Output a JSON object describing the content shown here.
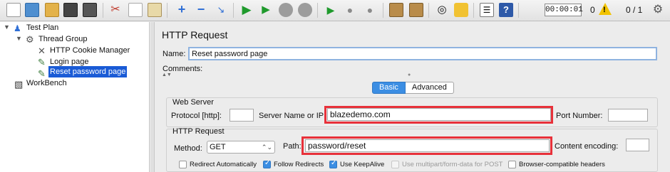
{
  "toolbar": {
    "icons": [
      "new-icon",
      "templates-icon",
      "open-icon",
      "save-icon",
      "save-as-icon",
      "cut-icon",
      "copy-icon",
      "paste-icon",
      "expand-icon",
      "collapse-icon",
      "toggle-icon",
      "start-icon",
      "start-no-pause-icon",
      "stop-icon",
      "shutdown-icon",
      "remote-start-icon",
      "remote-stop-icon",
      "remote-shutdown-icon",
      "clear-icon",
      "clear-all-icon",
      "search-icon",
      "reset-search-icon",
      "function-helper-icon",
      "help-icon"
    ],
    "timer": "00:00:01",
    "warning_count": "0",
    "threads": "0 / 1"
  },
  "tree": {
    "items": [
      {
        "label": "Test Plan"
      },
      {
        "label": "Thread Group"
      },
      {
        "label": "HTTP Cookie Manager"
      },
      {
        "label": "Login page"
      },
      {
        "label": "Reset password page"
      },
      {
        "label": "WorkBench"
      }
    ]
  },
  "panel": {
    "title": "HTTP Request",
    "name_label": "Name:",
    "name_value": "Reset password page",
    "comments_label": "Comments:",
    "tabs": [
      "Basic",
      "Advanced"
    ],
    "web_server": {
      "legend": "Web Server",
      "protocol_label": "Protocol [http]:",
      "protocol_value": "",
      "server_label": "Server Name or IP:",
      "server_value": "blazedemo.com",
      "port_label": "Port Number:",
      "port_value": ""
    },
    "http_request": {
      "legend": "HTTP Request",
      "method_label": "Method:",
      "method_value": "GET",
      "path_label": "Path:",
      "path_value": "password/reset",
      "encoding_label": "Content encoding:",
      "encoding_value": ""
    },
    "options": [
      {
        "label": "Redirect Automatically",
        "checked": false,
        "enabled": true
      },
      {
        "label": "Follow Redirects",
        "checked": true,
        "enabled": true
      },
      {
        "label": "Use KeepAlive",
        "checked": true,
        "enabled": true
      },
      {
        "label": "Use multipart/form-data for POST",
        "checked": false,
        "enabled": false
      },
      {
        "label": "Browser-compatible headers",
        "checked": false,
        "enabled": true
      }
    ]
  },
  "colors": {
    "highlight": "#e8313a",
    "selection": "#1a5bd6",
    "accent": "#3c8ee3"
  }
}
